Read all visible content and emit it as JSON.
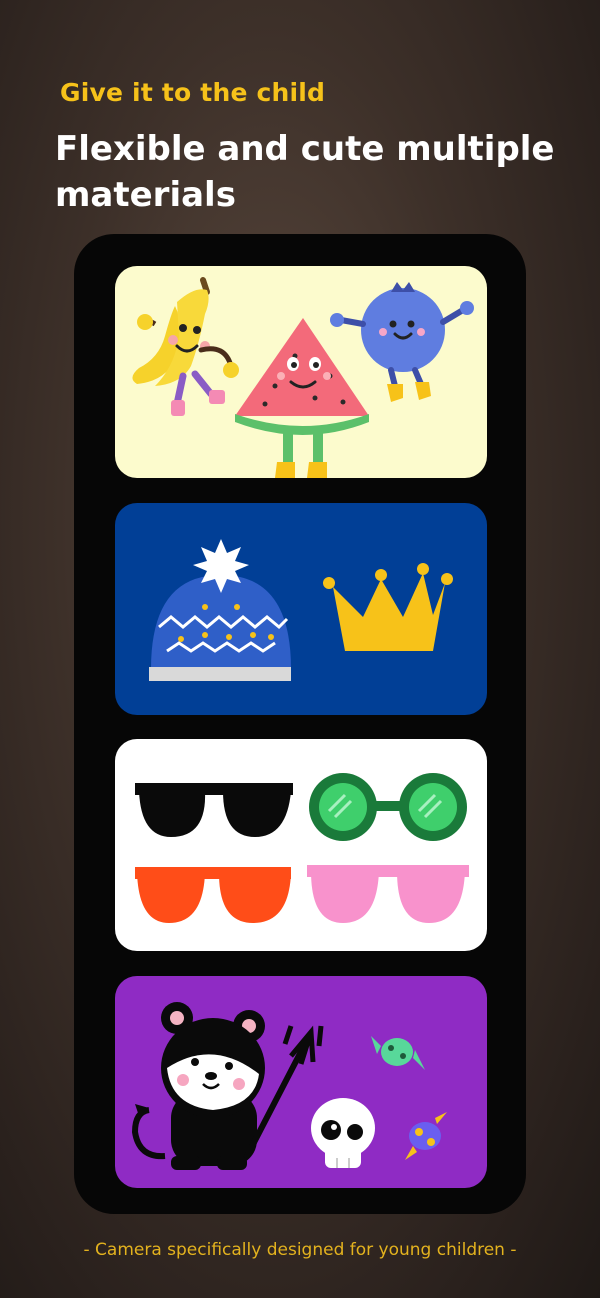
{
  "header": {
    "subtitle": "Give it to the child",
    "title": "Flexible and cute multiple materials"
  },
  "cards": [
    {
      "theme": "fruit-characters",
      "items": [
        "banana-icon",
        "watermelon-icon",
        "blueberry-icon"
      ],
      "background": "#fcfbcd"
    },
    {
      "theme": "hats",
      "items": [
        "beanie-hat-icon",
        "crown-icon"
      ],
      "background": "#013f96"
    },
    {
      "theme": "glasses",
      "items": [
        "black-sunglasses-icon",
        "green-glasses-icon",
        "orange-sunglasses-icon",
        "pink-sunglasses-icon"
      ],
      "background": "#ffffff"
    },
    {
      "theme": "halloween",
      "items": [
        "devil-bear-icon",
        "skull-icon",
        "candy-icon"
      ],
      "background": "#8f2bc4"
    }
  ],
  "footer": {
    "tagline": "- Camera specifically designed for young children -"
  },
  "colors": {
    "accent": "#f6c21a",
    "title": "#ffffff",
    "phone_frame": "#060606"
  }
}
